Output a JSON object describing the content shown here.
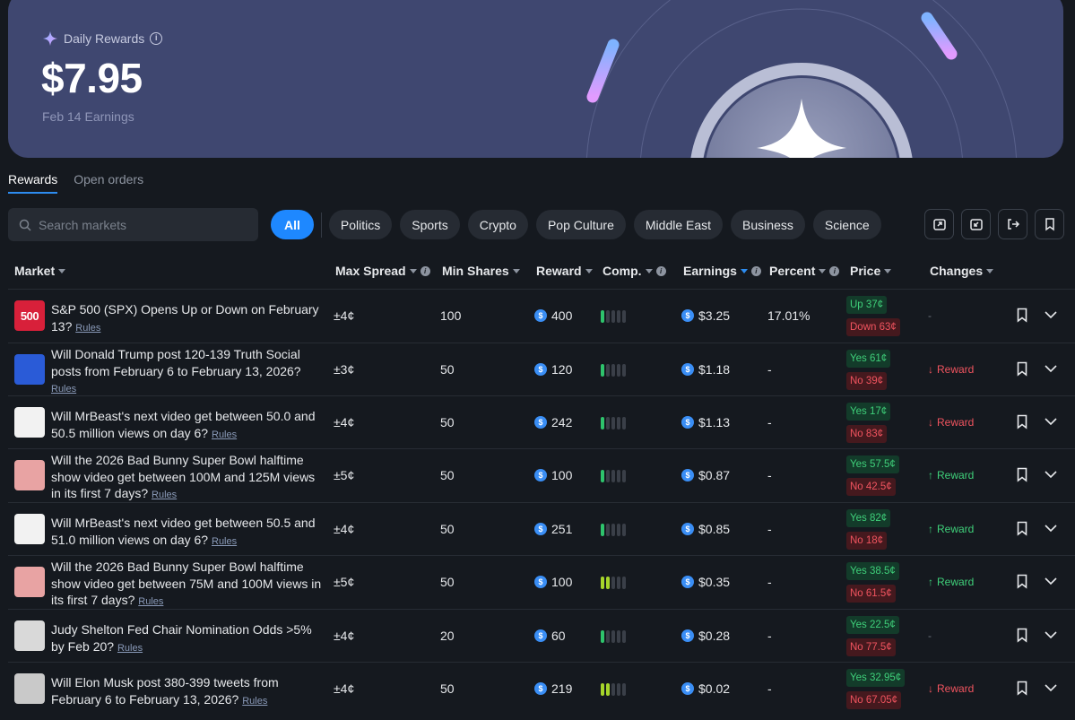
{
  "hero": {
    "label": "Daily Rewards",
    "amount": "$7.95",
    "subtitle": "Feb 14 Earnings"
  },
  "tabs": [
    {
      "label": "Rewards",
      "active": true
    },
    {
      "label": "Open orders",
      "active": false
    }
  ],
  "search": {
    "placeholder": "Search markets",
    "value": ""
  },
  "filters": [
    "All",
    "Politics",
    "Sports",
    "Crypto",
    "Pop Culture",
    "Middle East",
    "Business",
    "Science"
  ],
  "toolbar_icons": [
    "export-icon",
    "import-icon",
    "logout-icon",
    "bookmark-icon"
  ],
  "columns": {
    "market": "Market",
    "max_spread": "Max Spread",
    "min_shares": "Min Shares",
    "reward": "Reward",
    "comp": "Comp.",
    "earnings": "Earnings",
    "percent": "Percent",
    "price": "Price",
    "changes": "Changes"
  },
  "rows": [
    {
      "title": "S&P 500 (SPX) Opens Up or Down on February 13?",
      "thumb": "500",
      "thumb_color": "#d8203a",
      "spread": "±4¢",
      "shares": "100",
      "reward": "400",
      "comp": 1,
      "comp_color": "green",
      "earnings": "$3.25",
      "percent": "17.01%",
      "yes": "Up 37¢",
      "no": "Down 63¢",
      "change": "-",
      "change_dir": "none"
    },
    {
      "title": "Will Donald Trump post 120-139 Truth Social posts from February 6 to February 13, 2026?",
      "thumb": "",
      "thumb_color": "#2a5bd7",
      "spread": "±3¢",
      "shares": "50",
      "reward": "120",
      "comp": 1,
      "comp_color": "green",
      "earnings": "$1.18",
      "percent": "-",
      "yes": "Yes 61¢",
      "no": "No 39¢",
      "change": "Reward",
      "change_dir": "down"
    },
    {
      "title": "Will MrBeast's next video get between 50.0 and 50.5 million views on day 6?",
      "thumb": "",
      "thumb_color": "#f2f2f2",
      "spread": "±4¢",
      "shares": "50",
      "reward": "242",
      "comp": 1,
      "comp_color": "green",
      "earnings": "$1.13",
      "percent": "-",
      "yes": "Yes 17¢",
      "no": "No 83¢",
      "change": "Reward",
      "change_dir": "down"
    },
    {
      "title": "Will the 2026 Bad Bunny Super Bowl halftime show video get between 100M and 125M views in its first 7 days?",
      "thumb": "",
      "thumb_color": "#e8a3a3",
      "spread": "±5¢",
      "shares": "50",
      "reward": "100",
      "comp": 1,
      "comp_color": "green",
      "earnings": "$0.87",
      "percent": "-",
      "yes": "Yes 57.5¢",
      "no": "No 42.5¢",
      "change": "Reward",
      "change_dir": "up"
    },
    {
      "title": "Will MrBeast's next video get between 50.5 and 51.0 million views on day 6?",
      "thumb": "",
      "thumb_color": "#f2f2f2",
      "spread": "±4¢",
      "shares": "50",
      "reward": "251",
      "comp": 1,
      "comp_color": "green",
      "earnings": "$0.85",
      "percent": "-",
      "yes": "Yes 82¢",
      "no": "No 18¢",
      "change": "Reward",
      "change_dir": "up"
    },
    {
      "title": "Will the 2026 Bad Bunny Super Bowl halftime show video get between 75M and 100M views in its first 7 days?",
      "thumb": "",
      "thumb_color": "#e8a3a3",
      "spread": "±5¢",
      "shares": "50",
      "reward": "100",
      "comp": 2,
      "comp_color": "lime",
      "earnings": "$0.35",
      "percent": "-",
      "yes": "Yes 38.5¢",
      "no": "No 61.5¢",
      "change": "Reward",
      "change_dir": "up"
    },
    {
      "title": "Judy Shelton Fed Chair Nomination Odds >5% by Feb 20?",
      "thumb": "",
      "thumb_color": "#d9d9d9",
      "spread": "±4¢",
      "shares": "20",
      "reward": "60",
      "comp": 1,
      "comp_color": "green",
      "earnings": "$0.28",
      "percent": "-",
      "yes": "Yes 22.5¢",
      "no": "No 77.5¢",
      "change": "-",
      "change_dir": "none"
    },
    {
      "title": "Will Elon Musk post 380-399 tweets from February 6 to February 13, 2026?",
      "thumb": "",
      "thumb_color": "#c9c9c9",
      "spread": "±4¢",
      "shares": "50",
      "reward": "219",
      "comp": 2,
      "comp_color": "lime",
      "earnings": "$0.02",
      "percent": "-",
      "yes": "Yes 32.95¢",
      "no": "No 67.05¢",
      "change": "Reward",
      "change_dir": "down"
    }
  ],
  "rules_label": "Rules",
  "colors": {
    "accent": "#1e88ff",
    "yes": "#3fd07a",
    "no": "#f0545f",
    "hero": "#3f4770"
  }
}
